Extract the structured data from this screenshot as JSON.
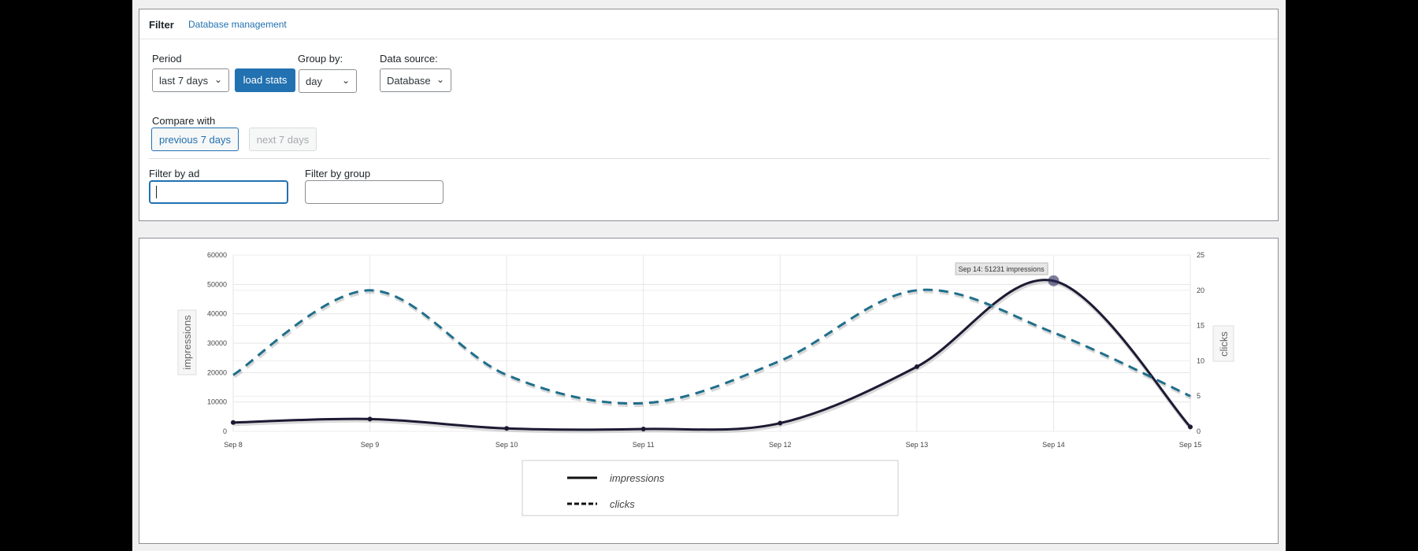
{
  "tabs": {
    "filter": "Filter",
    "db": "Database management"
  },
  "period": {
    "label": "Period",
    "value": "last 7 days",
    "load": "load stats"
  },
  "group": {
    "label": "Group by:",
    "value": "day"
  },
  "source": {
    "label": "Data source:",
    "value": "Database"
  },
  "compare": {
    "label": "Compare with",
    "prev": "previous 7 days",
    "next": "next 7 days"
  },
  "filters": {
    "ad_label": "Filter by ad",
    "group_label": "Filter by group",
    "ad_value": "",
    "group_value": ""
  },
  "colors": {
    "accent": "#2271b1",
    "impressions": "#1c1a33",
    "clicks": "#1f6f8b"
  },
  "chart_data": {
    "type": "line",
    "categories": [
      "Sep 8",
      "Sep 9",
      "Sep 10",
      "Sep 11",
      "Sep 12",
      "Sep 13",
      "Sep 14",
      "Sep 15"
    ],
    "series": [
      {
        "name": "impressions",
        "axis": "left",
        "style": "solid",
        "values": [
          3000,
          4200,
          1000,
          800,
          2800,
          22000,
          51231,
          1500
        ]
      },
      {
        "name": "clicks",
        "axis": "right",
        "style": "dashed",
        "values": [
          8,
          20,
          8,
          4,
          10,
          20,
          14,
          5
        ]
      }
    ],
    "ylabel": "impressions",
    "y2label": "clicks",
    "ylim": [
      0,
      60000
    ],
    "yticks": [
      "0",
      "10000",
      "20000",
      "30000",
      "40000",
      "50000",
      "60000"
    ],
    "y2lim": [
      0,
      25
    ],
    "y2ticks": [
      "0",
      "5",
      "10",
      "15",
      "20",
      "25"
    ],
    "tooltip": "Sep 14: 51231 impressions",
    "legend": [
      "impressions",
      "clicks"
    ],
    "legend_position": "bottom-center",
    "grid": true
  }
}
